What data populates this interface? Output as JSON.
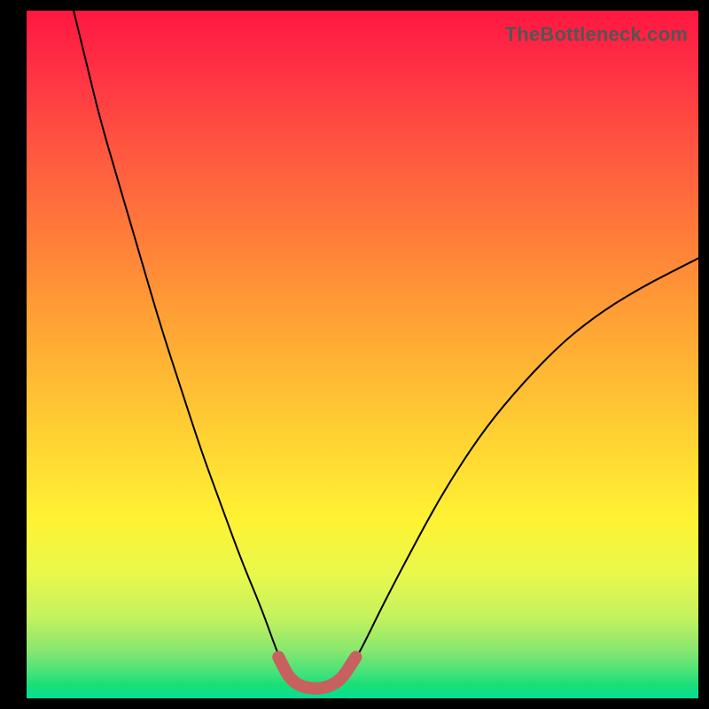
{
  "watermark": "TheBottleneck.com",
  "chart_data": {
    "type": "line",
    "title": "",
    "xlabel": "",
    "ylabel": "",
    "xlim": [
      0,
      1
    ],
    "ylim": [
      0,
      1
    ],
    "background_gradient": {
      "direction": "vertical",
      "stops": [
        {
          "pos": 0.0,
          "color": "#ff1740"
        },
        {
          "pos": 0.62,
          "color": "#ffd233"
        },
        {
          "pos": 0.93,
          "color": "#88e76f"
        },
        {
          "pos": 1.0,
          "color": "#05dd97"
        }
      ]
    },
    "series": [
      {
        "name": "left-branch",
        "stroke": "#000000",
        "stroke_width": 2,
        "points": [
          {
            "x": 0.07,
            "y": 1.0
          },
          {
            "x": 0.09,
            "y": 0.92
          },
          {
            "x": 0.11,
            "y": 0.84
          },
          {
            "x": 0.14,
            "y": 0.74
          },
          {
            "x": 0.17,
            "y": 0.64
          },
          {
            "x": 0.2,
            "y": 0.54
          },
          {
            "x": 0.23,
            "y": 0.45
          },
          {
            "x": 0.26,
            "y": 0.36
          },
          {
            "x": 0.29,
            "y": 0.28
          },
          {
            "x": 0.32,
            "y": 0.2
          },
          {
            "x": 0.35,
            "y": 0.13
          },
          {
            "x": 0.37,
            "y": 0.075
          },
          {
            "x": 0.385,
            "y": 0.04
          }
        ]
      },
      {
        "name": "right-branch",
        "stroke": "#000000",
        "stroke_width": 2,
        "points": [
          {
            "x": 0.48,
            "y": 0.04
          },
          {
            "x": 0.5,
            "y": 0.075
          },
          {
            "x": 0.53,
            "y": 0.135
          },
          {
            "x": 0.57,
            "y": 0.21
          },
          {
            "x": 0.62,
            "y": 0.3
          },
          {
            "x": 0.68,
            "y": 0.39
          },
          {
            "x": 0.74,
            "y": 0.46
          },
          {
            "x": 0.8,
            "y": 0.52
          },
          {
            "x": 0.86,
            "y": 0.565
          },
          {
            "x": 0.92,
            "y": 0.6
          },
          {
            "x": 0.97,
            "y": 0.625
          },
          {
            "x": 1.0,
            "y": 0.64
          }
        ]
      },
      {
        "name": "highlight-valley",
        "stroke": "#c7605f",
        "stroke_width": 14,
        "linecap": "round",
        "points": [
          {
            "x": 0.375,
            "y": 0.06
          },
          {
            "x": 0.395,
            "y": 0.022
          },
          {
            "x": 0.43,
            "y": 0.012
          },
          {
            "x": 0.465,
            "y": 0.022
          },
          {
            "x": 0.49,
            "y": 0.06
          }
        ]
      }
    ]
  }
}
